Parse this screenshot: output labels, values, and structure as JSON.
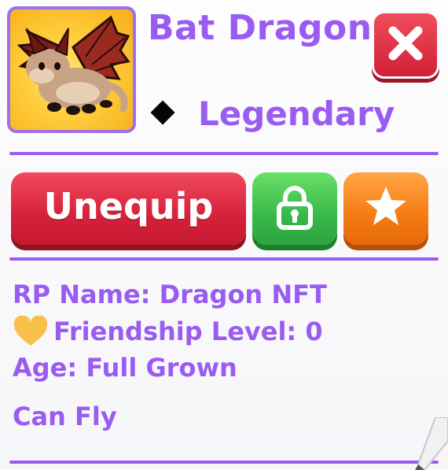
{
  "pet": {
    "name": "Bat Dragon",
    "rarity": "Legendary",
    "image_icon": "bat-dragon-pet-icon"
  },
  "actions": {
    "unequip_label": "Unequip",
    "lock_icon": "padlock-icon",
    "favorite_icon": "star-icon",
    "close_icon": "close-x-icon"
  },
  "info": {
    "rp_name": "RP Name: Dragon NFT",
    "friendship": "Friendship Level: 0",
    "age": "Age: Full Grown",
    "ability": "Can Fly"
  },
  "colors": {
    "accent_purple": "#9a5cf0",
    "close_red": "#d11f36",
    "unequip_red": "#d6213a",
    "lock_green": "#37b948",
    "favorite_orange": "#f57b14",
    "heart_gold": "#f7c04a"
  }
}
